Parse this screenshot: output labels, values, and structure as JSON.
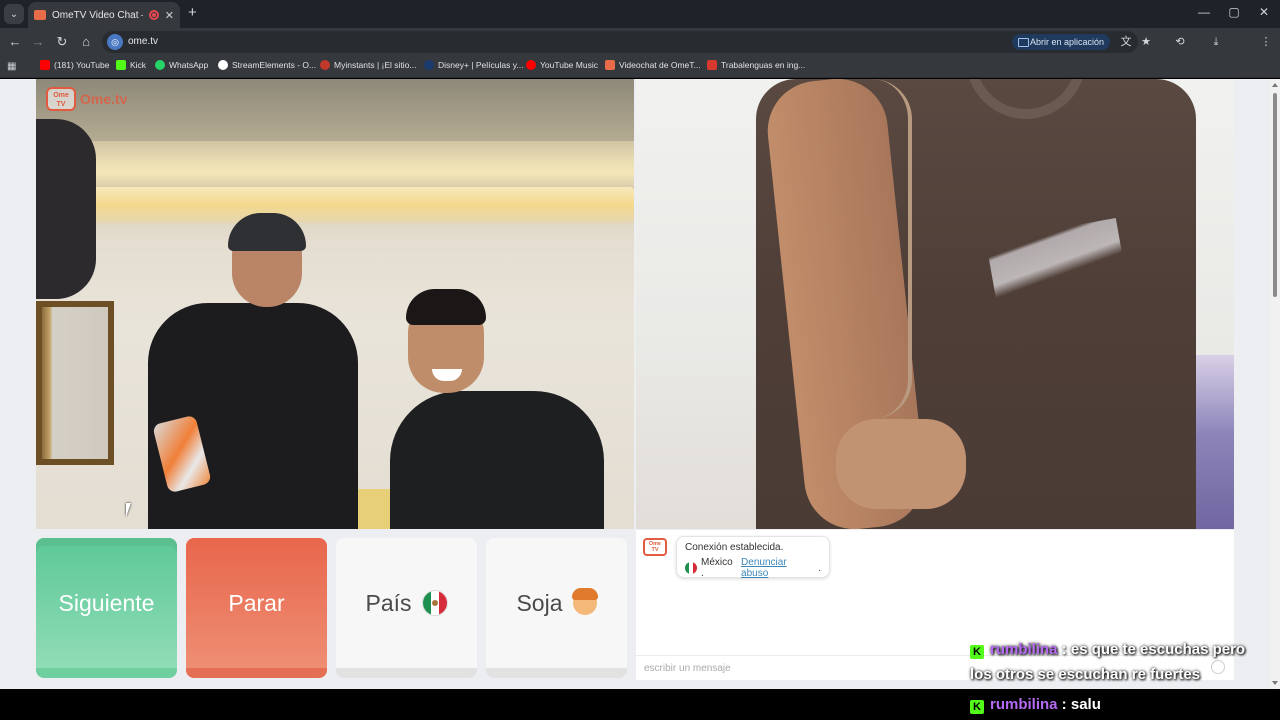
{
  "browser": {
    "tab_title": "OmeTV Video Chat — Alte",
    "tab_close": "✕",
    "new_tab": "+",
    "url": "ome.tv",
    "open_in_app": "Abrir en aplicación",
    "window_controls": {
      "minimize": "—",
      "maximize": "▢",
      "close": "✕"
    },
    "nav": {
      "back": "←",
      "forward": "→",
      "reload": "↻",
      "home": "⌂"
    },
    "bookmarks": [
      {
        "label": "(181) YouTube",
        "icon_color": "#ff0000"
      },
      {
        "label": "Kick",
        "icon_color": "#53fc18"
      },
      {
        "label": "WhatsApp",
        "icon_color": "#25d366"
      },
      {
        "label": "StreamElements - O...",
        "icon_color": "#ffffff"
      },
      {
        "label": "Myinstants | ¡El sitio...",
        "icon_color": "#c0392b"
      },
      {
        "label": "Disney+ | Películas y...",
        "icon_color": "#1b3b6f"
      },
      {
        "label": "YouTube Music",
        "icon_color": "#ff0000"
      },
      {
        "label": "Videochat de OmeT...",
        "icon_color": "#e86b4a"
      },
      {
        "label": "Trabalenguas en ing...",
        "icon_color": "#d63a2f"
      }
    ]
  },
  "ometv": {
    "logo_text": "Ome.tv",
    "logo_badge": "Ome TV",
    "buttons": {
      "next": "Siguiente",
      "stop": "Parar",
      "country": "País",
      "gender": "Soja"
    },
    "chat": {
      "status": "Conexión establecida.",
      "country": "México .",
      "report_link": "Denunciar abuso",
      "report_suffix": ".",
      "input_placeholder": "escribir un mensaje"
    }
  },
  "stream_chat": [
    {
      "badge": "K",
      "username": "rumbilina",
      "line1": " : es que te escuchas pero",
      "line2": "los otros se escuchan re fuertes"
    },
    {
      "badge": "K",
      "username": "rumbilina",
      "text": " : salu"
    }
  ],
  "colors": {
    "next_green": "#5cc897",
    "stop_red": "#e8664c",
    "kick_green": "#53fc18",
    "username_purple": "#b56af3",
    "ometv_accent": "#e25b40"
  }
}
